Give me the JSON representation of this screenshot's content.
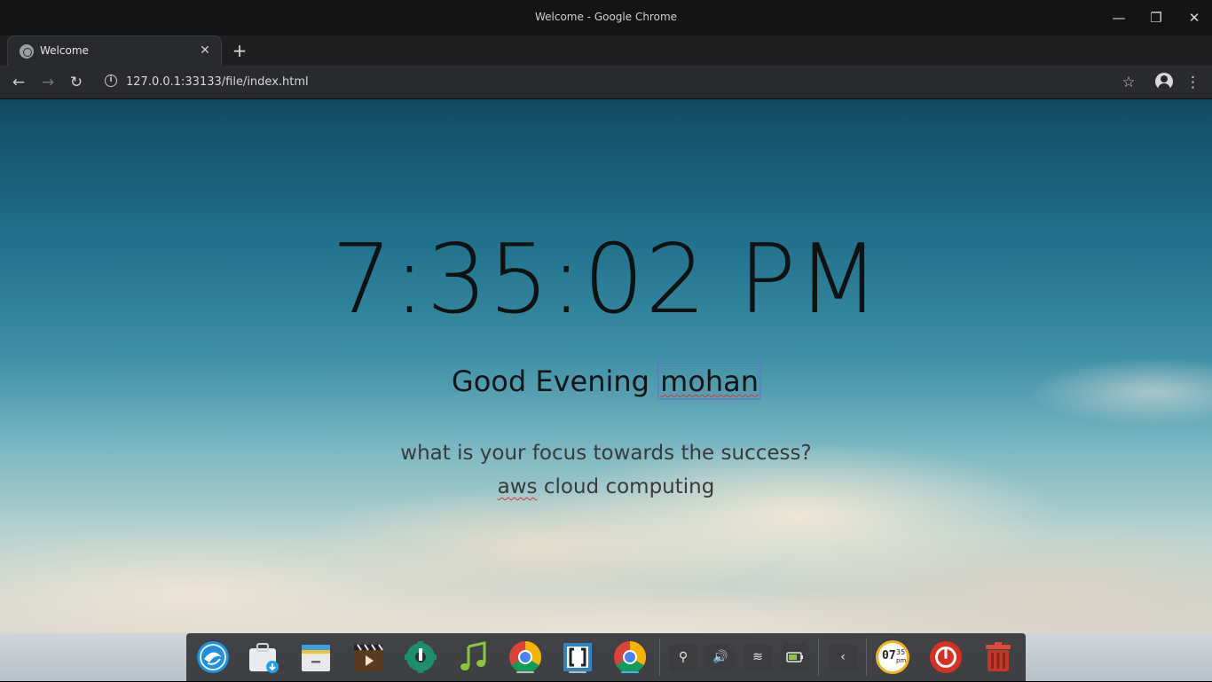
{
  "window": {
    "title": "Welcome - Google Chrome",
    "minimize": "—",
    "restore": "❐",
    "close": "✕"
  },
  "tab": {
    "label": "Welcome",
    "close": "✕",
    "new_tab": "+"
  },
  "toolbar": {
    "back": "←",
    "forward": "→",
    "reload": "↻",
    "info": "i",
    "url": "127.0.0.1:33133/file/index.html",
    "bookmark": "☆",
    "menu": "⋮"
  },
  "page": {
    "time": "7:35:02 PM",
    "greeting_prefix": "Good Evening",
    "name": "mohan",
    "focus_question": "what is your focus towards the success?",
    "focus_answer_word1": "aws",
    "focus_answer_rest": "cloud computing"
  },
  "dock": {
    "apps": [
      {
        "name": "deepin-launcher-icon"
      },
      {
        "name": "app-store-icon"
      },
      {
        "name": "file-manager-icon"
      },
      {
        "name": "movie-player-icon"
      },
      {
        "name": "settings-icon"
      },
      {
        "name": "music-icon"
      },
      {
        "name": "chrome-icon"
      },
      {
        "name": "brackets-icon"
      },
      {
        "name": "chrome-alt-icon"
      }
    ],
    "tray": {
      "usb": "⚲",
      "volume": "🔊",
      "wifi": "≋",
      "battery": "▭",
      "collapse": "‹"
    },
    "clock_hour": "07",
    "clock_min": "35",
    "clock_ampm": "pm"
  }
}
